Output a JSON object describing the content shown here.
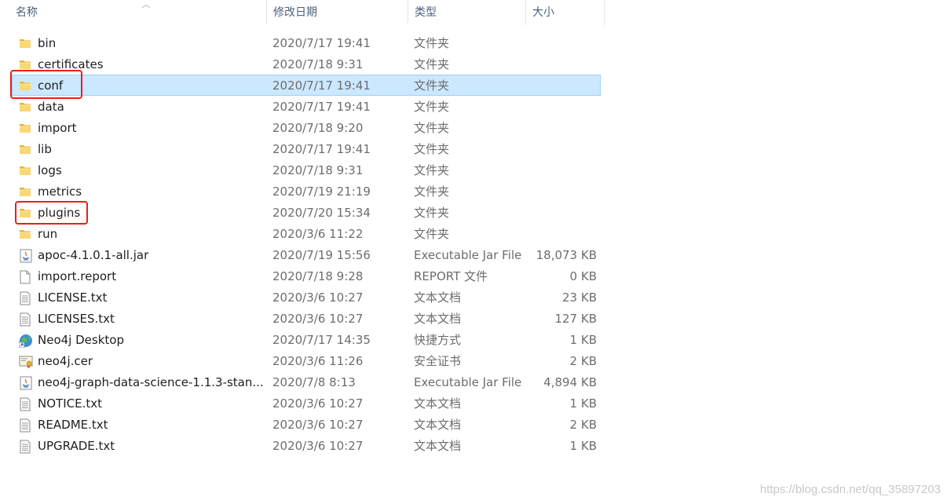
{
  "columns": {
    "name": "名称",
    "modified": "修改日期",
    "type": "类型",
    "size": "大小"
  },
  "files": [
    {
      "name": "bin",
      "date": "2020/7/17 19:41",
      "type": "文件夹",
      "size": "",
      "icon": "folder-icon"
    },
    {
      "name": "certificates",
      "date": "2020/7/18 9:31",
      "type": "文件夹",
      "size": "",
      "icon": "folder-icon"
    },
    {
      "name": "conf",
      "date": "2020/7/17 19:41",
      "type": "文件夹",
      "size": "",
      "icon": "folder-icon",
      "selected": true
    },
    {
      "name": "data",
      "date": "2020/7/17 19:41",
      "type": "文件夹",
      "size": "",
      "icon": "folder-icon"
    },
    {
      "name": "import",
      "date": "2020/7/18 9:20",
      "type": "文件夹",
      "size": "",
      "icon": "folder-icon"
    },
    {
      "name": "lib",
      "date": "2020/7/17 19:41",
      "type": "文件夹",
      "size": "",
      "icon": "folder-icon"
    },
    {
      "name": "logs",
      "date": "2020/7/18 9:31",
      "type": "文件夹",
      "size": "",
      "icon": "folder-icon"
    },
    {
      "name": "metrics",
      "date": "2020/7/19 21:19",
      "type": "文件夹",
      "size": "",
      "icon": "folder-icon"
    },
    {
      "name": "plugins",
      "date": "2020/7/20 15:34",
      "type": "文件夹",
      "size": "",
      "icon": "folder-icon"
    },
    {
      "name": "run",
      "date": "2020/3/6 11:22",
      "type": "文件夹",
      "size": "",
      "icon": "folder-icon"
    },
    {
      "name": "apoc-4.1.0.1-all.jar",
      "date": "2020/7/19 15:56",
      "type": "Executable Jar File",
      "size": "18,073 KB",
      "icon": "jar-file-icon"
    },
    {
      "name": "import.report",
      "date": "2020/7/18 9:28",
      "type": "REPORT 文件",
      "size": "0 KB",
      "icon": "blank-file-icon"
    },
    {
      "name": "LICENSE.txt",
      "date": "2020/3/6 10:27",
      "type": "文本文档",
      "size": "23 KB",
      "icon": "text-file-icon"
    },
    {
      "name": "LICENSES.txt",
      "date": "2020/3/6 10:27",
      "type": "文本文档",
      "size": "127 KB",
      "icon": "text-file-icon"
    },
    {
      "name": "Neo4j Desktop",
      "date": "2020/7/17 14:35",
      "type": "快捷方式",
      "size": "1 KB",
      "icon": "globe-shortcut-icon"
    },
    {
      "name": "neo4j.cer",
      "date": "2020/3/6 11:26",
      "type": "安全证书",
      "size": "2 KB",
      "icon": "certificate-icon"
    },
    {
      "name": "neo4j-graph-data-science-1.1.3-stan...",
      "date": "2020/7/8 8:13",
      "type": "Executable Jar File",
      "size": "4,894 KB",
      "icon": "jar-file-icon"
    },
    {
      "name": "NOTICE.txt",
      "date": "2020/3/6 10:27",
      "type": "文本文档",
      "size": "1 KB",
      "icon": "text-file-icon"
    },
    {
      "name": "README.txt",
      "date": "2020/3/6 10:27",
      "type": "文本文档",
      "size": "2 KB",
      "icon": "text-file-icon"
    },
    {
      "name": "UPGRADE.txt",
      "date": "2020/3/6 10:27",
      "type": "文本文档",
      "size": "1 KB",
      "icon": "text-file-icon"
    }
  ],
  "watermark": "https://blog.csdn.net/qq_35897203",
  "colors": {
    "selection_bg": "#cce8ff",
    "selection_border": "#99d1ff",
    "highlight_red": "#e8201b",
    "folder_yellow": "#f5c842"
  }
}
